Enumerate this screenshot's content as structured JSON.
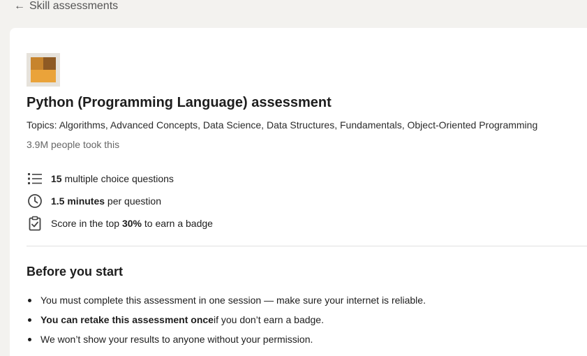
{
  "nav": {
    "back_label": "Skill assessments"
  },
  "assessment": {
    "title": "Python (Programming Language) assessment",
    "topics": "Topics: Algorithms, Advanced Concepts, Data Science, Data Structures, Fundamentals, Object-Oriented Programming",
    "took": "3.9M people took this",
    "logo_colors": {
      "top_left": "#c7842d",
      "top_right": "#8e5a24",
      "bottom": "#eaa33a"
    }
  },
  "facts": [
    {
      "icon": "list-icon",
      "bold": "15",
      "text": " multiple choice questions"
    },
    {
      "icon": "clock-icon",
      "bold": "1.5 minutes",
      "text": " per question"
    },
    {
      "icon": "clipboard-check-icon",
      "pre": "Score in the top ",
      "bold": "30%",
      "text": " to earn a badge"
    }
  ],
  "before": {
    "title": "Before you start",
    "rules": [
      {
        "text": "You must complete this assessment in one session — make sure your internet is reliable."
      },
      {
        "bold": "You can retake this assessment once",
        "text": " if you don’t earn a badge."
      },
      {
        "text": "We won’t show your results to anyone without your permission."
      }
    ]
  }
}
